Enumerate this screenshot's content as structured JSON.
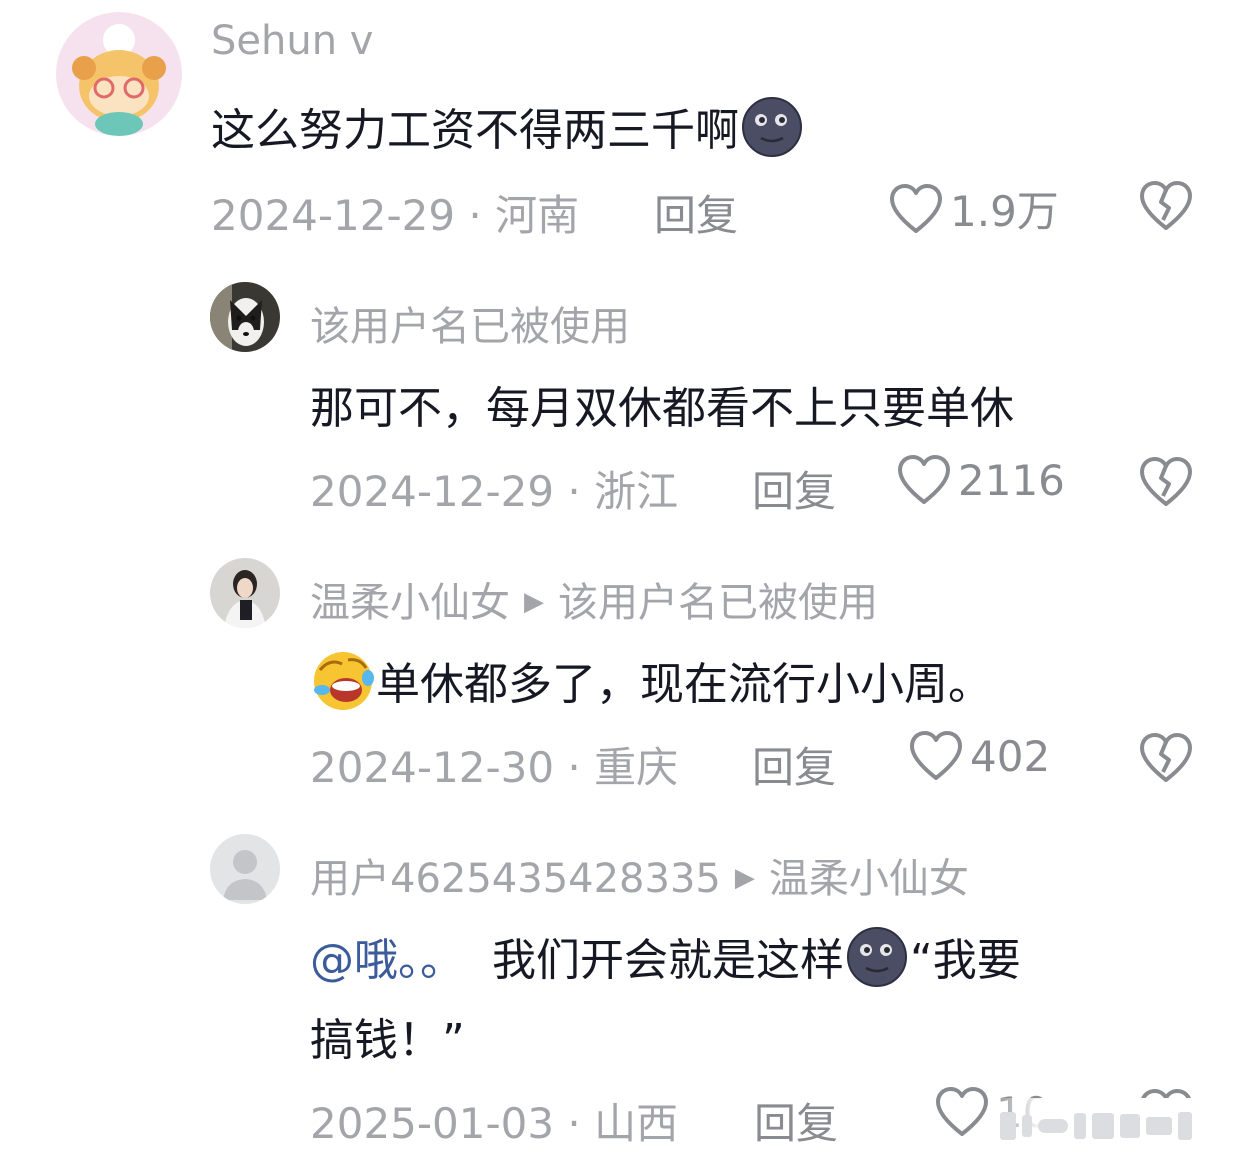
{
  "comments": [
    {
      "username": "Sehun v",
      "text_before": "这么努力工资不得两三千啊",
      "date_location": "2024-12-29 · 河南",
      "reply_label": "回复",
      "likes": "1.9万"
    },
    {
      "username": "该用户名已被使用",
      "text": "那可不，每月双休都看不上只要单休",
      "date_location": "2024-12-29 · 浙江",
      "reply_label": "回复",
      "likes": "2116"
    },
    {
      "username": "温柔小仙女",
      "reply_to": "该用户名已被使用",
      "text_after": "单休都多了，现在流行小小周。",
      "date_location": "2024-12-30 · 重庆",
      "reply_label": "回复",
      "likes": "402"
    },
    {
      "username": "用户4625435428335",
      "reply_to": "温柔小仙女",
      "mention": "@哦。。",
      "text_mid": "我们开会就是这样",
      "text_quote": "“我要",
      "text_line2": "搞钱！”",
      "date_location": "2025-01-03 · 山西",
      "reply_label": "回复",
      "likes": "10"
    }
  ],
  "icons": {
    "like": "heart-outline-icon",
    "dislike": "broken-heart-icon",
    "reply_arrow": "triangle-right-icon",
    "emoji_moon": "new-moon-face-emoji",
    "emoji_laugh": "rolling-laughing-emoji"
  },
  "colors": {
    "username": "#a4a5aa",
    "text": "#161823",
    "mention": "#3b5b9a",
    "meta": "#a4a5aa"
  }
}
